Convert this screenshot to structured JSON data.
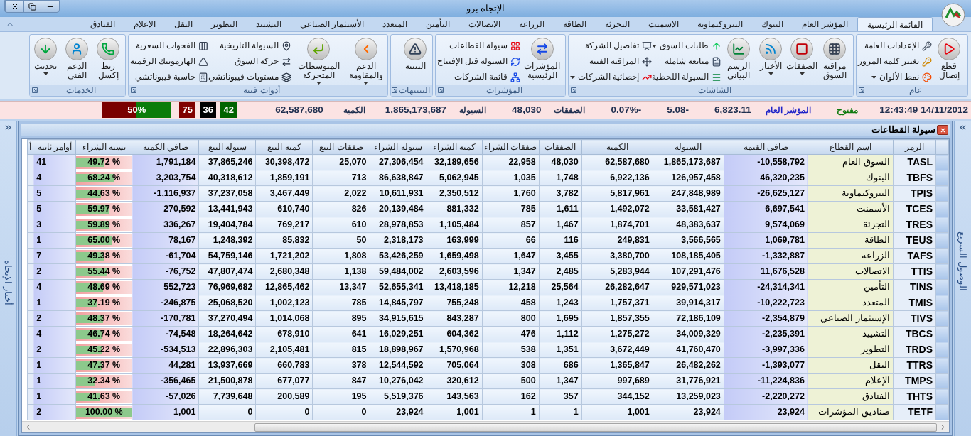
{
  "window": {
    "title": "الإتجاه برو"
  },
  "tabs": [
    {
      "label": "القائمة الرئيسية",
      "selected": true
    },
    {
      "label": "المؤشر العام",
      "selected": false
    },
    {
      "label": "البنوك",
      "selected": false
    },
    {
      "label": "البتروكيماوية",
      "selected": false
    },
    {
      "label": "الاسمنت",
      "selected": false
    },
    {
      "label": "التجزئة",
      "selected": false
    },
    {
      "label": "الطاقة",
      "selected": false
    },
    {
      "label": "الزراعة",
      "selected": false
    },
    {
      "label": "الاتصالات",
      "selected": false
    },
    {
      "label": "التأمين",
      "selected": false
    },
    {
      "label": "المتعدد",
      "selected": false
    },
    {
      "label": "الأستثمار الصناعي",
      "selected": false
    },
    {
      "label": "التشييد",
      "selected": false
    },
    {
      "label": "التطوير",
      "selected": false
    },
    {
      "label": "النقل",
      "selected": false
    },
    {
      "label": "الاعلام",
      "selected": false
    },
    {
      "label": "الفنادق",
      "selected": false
    }
  ],
  "ribbon": [
    {
      "title": "عام",
      "large": [
        {
          "label": "قطع إتصال",
          "dropdown": false
        }
      ],
      "small": [
        [
          {
            "label": "الإعدادات العامة",
            "dropdown": false
          },
          {
            "label": "تغيير كلمة المرور",
            "dropdown": false
          },
          {
            "label": "نمط الألوان",
            "dropdown": true
          }
        ]
      ]
    },
    {
      "title": "الشاشات",
      "large": [
        {
          "label": "مراقبة السوق",
          "dropdown": false
        },
        {
          "label": "الصفقات",
          "dropdown": true
        },
        {
          "label": "الأخبار",
          "dropdown": true
        },
        {
          "label": "الرسم البيانى",
          "dropdown": false
        }
      ],
      "small": [
        [
          {
            "label": "طلبات السوق",
            "dropdown": true
          },
          {
            "label": "متابعة شاملة",
            "dropdown": false
          },
          {
            "label": "السيولة اللحظية",
            "dropdown": false
          }
        ],
        [
          {
            "label": "تفاصيل الشركة",
            "dropdown": false
          },
          {
            "label": "المراقبة الفنية",
            "dropdown": false
          },
          {
            "label": "إحصائية الشركات",
            "dropdown": true
          }
        ]
      ]
    },
    {
      "title": "المؤشرات",
      "large": [
        {
          "label": "المؤشرات الرئيسية",
          "dropdown": false
        }
      ],
      "small": [
        [
          {
            "label": "سيولة القطاعات",
            "dropdown": false
          },
          {
            "label": "السيولة قبل الإفتتاح",
            "dropdown": false
          },
          {
            "label": "قائمة الشركات",
            "dropdown": false
          }
        ]
      ]
    },
    {
      "title": "التنبيهات",
      "large": [
        {
          "label": "التنبيه",
          "dropdown": false
        }
      ]
    },
    {
      "title": "أدوات فنية",
      "large": [
        {
          "label": "الدعم والمقاومة",
          "dropdown": true
        },
        {
          "label": "المتوسطات المتحركة",
          "dropdown": true
        }
      ],
      "small": [
        [
          {
            "label": "السيولة التاريخية",
            "dropdown": false
          },
          {
            "label": "حركة السوق",
            "dropdown": false
          },
          {
            "label": "مستويات فيبوناتشي",
            "dropdown": false
          }
        ],
        [
          {
            "label": "الفجوات السعرية",
            "dropdown": false
          },
          {
            "label": "الهارمونيك الرقمية",
            "dropdown": false
          },
          {
            "label": "حاسبة فيبوناتشي",
            "dropdown": false
          }
        ]
      ]
    },
    {
      "title": "الخدمات",
      "large": [
        {
          "label": "ربط إكسل",
          "dropdown": false
        },
        {
          "label": "الدعم الفني",
          "dropdown": false
        },
        {
          "label": "تحديث",
          "dropdown": true
        }
      ]
    }
  ],
  "ticker": {
    "date": "14/11/2012",
    "time": "12:43:49",
    "status": "مفتوح",
    "index_link": "المؤشر العام",
    "index_value": "6,823.11",
    "change": "5.08-",
    "change_pct": "0.07%-",
    "deals_label": "الصفقات",
    "deals": "48,030",
    "liquidity_label": "السيولة",
    "liquidity": "1,865,173,687",
    "quantity_label": "الكمية",
    "quantity": "62,587,680",
    "counts": [
      {
        "text": "42",
        "color": "#006400"
      },
      {
        "text": "36",
        "color": "#000000"
      },
      {
        "text": "75",
        "color": "#800000"
      }
    ],
    "ratio": {
      "text": "50%",
      "level": 0.5
    }
  },
  "side_panels": {
    "left": "أخبار الإتجاه",
    "right": "الوصول السريع"
  },
  "table_window": {
    "title": "سيولة القطاعات",
    "columns": [
      "الرمز",
      "اسم القطاع",
      "صافى القيمة",
      "السيولة",
      "الكمية",
      "الصفقات",
      "صفقات الشراء",
      "كمية الشراء",
      "سيولة الشراء",
      "صفقات البيع",
      "كمية البيع",
      "سيولة البيع",
      "صافي الكمية",
      "نسبة الشراء",
      "أوامر ثابتة",
      "أ"
    ],
    "rows": [
      {
        "symbol": "TASL",
        "sector": "السوق العام",
        "values": [
          "-10,558,792",
          "1,865,173,687",
          "62,587,680",
          "48,030",
          "22,958",
          "32,189,656",
          "27,306,454",
          "25,070",
          "30,398,472",
          "37,865,246",
          "1,791,184"
        ],
        "buy_ratio": "49.72 %",
        "level": 0.4972,
        "fixed_orders": "41"
      },
      {
        "symbol": "TBFS",
        "sector": "البنوك",
        "values": [
          "46,320,235",
          "126,957,458",
          "6,922,136",
          "1,748",
          "1,035",
          "5,062,945",
          "86,638,847",
          "713",
          "1,859,191",
          "40,318,612",
          "3,203,754"
        ],
        "buy_ratio": "68.24 %",
        "level": 0.6824,
        "fixed_orders": "4"
      },
      {
        "symbol": "TPIS",
        "sector": "البتروكيماوية",
        "values": [
          "-26,625,127",
          "247,848,989",
          "5,817,961",
          "3,782",
          "1,760",
          "2,350,512",
          "10,611,931",
          "2,022",
          "3,467,449",
          "37,237,058",
          "-1,116,937"
        ],
        "buy_ratio": "44.63 %",
        "level": 0.4463,
        "fixed_orders": "5"
      },
      {
        "symbol": "TCES",
        "sector": "الأسمنت",
        "values": [
          "6,697,541",
          "33,581,427",
          "1,492,072",
          "1,611",
          "785",
          "881,332",
          "20,139,484",
          "826",
          "610,740",
          "13,441,943",
          "270,592"
        ],
        "buy_ratio": "59.97 %",
        "level": 0.5997,
        "fixed_orders": "5"
      },
      {
        "symbol": "TRES",
        "sector": "التجزئة",
        "values": [
          "9,574,069",
          "48,383,637",
          "1,874,701",
          "1,467",
          "857",
          "1,105,484",
          "28,978,853",
          "610",
          "769,217",
          "19,404,784",
          "336,267"
        ],
        "buy_ratio": "59.89 %",
        "level": 0.5989,
        "fixed_orders": "3"
      },
      {
        "symbol": "TEUS",
        "sector": "الطاقة",
        "values": [
          "1,069,781",
          "3,566,565",
          "249,831",
          "116",
          "66",
          "163,999",
          "2,318,173",
          "50",
          "85,832",
          "1,248,392",
          "78,167"
        ],
        "buy_ratio": "65.00 %",
        "level": 0.65,
        "fixed_orders": "1"
      },
      {
        "symbol": "TAFS",
        "sector": "الزراعة",
        "values": [
          "-1,332,887",
          "108,185,405",
          "3,380,700",
          "3,455",
          "1,647",
          "1,659,498",
          "53,426,259",
          "1,808",
          "1,721,202",
          "54,759,146",
          "-61,704"
        ],
        "buy_ratio": "49.38 %",
        "level": 0.4938,
        "fixed_orders": "7"
      },
      {
        "symbol": "TTIS",
        "sector": "الاتصالات",
        "values": [
          "11,676,528",
          "107,291,476",
          "5,283,944",
          "2,485",
          "1,347",
          "2,603,596",
          "59,484,002",
          "1,138",
          "2,680,348",
          "47,807,474",
          "-76,752"
        ],
        "buy_ratio": "55.44 %",
        "level": 0.5544,
        "fixed_orders": "2"
      },
      {
        "symbol": "TINS",
        "sector": "التأمين",
        "values": [
          "-24,314,341",
          "929,571,023",
          "26,282,647",
          "25,564",
          "12,218",
          "13,418,185",
          "52,655,341",
          "13,347",
          "12,865,462",
          "76,969,682",
          "552,723"
        ],
        "buy_ratio": "48.69 %",
        "level": 0.4869,
        "fixed_orders": "4"
      },
      {
        "symbol": "TMIS",
        "sector": "المتعدد",
        "values": [
          "-10,222,723",
          "39,914,317",
          "1,757,371",
          "1,243",
          "458",
          "755,248",
          "14,845,797",
          "785",
          "1,002,123",
          "25,068,520",
          "-246,875"
        ],
        "buy_ratio": "37.19 %",
        "level": 0.3719,
        "fixed_orders": "1"
      },
      {
        "symbol": "TIVS",
        "sector": "الإستثمار الصناعي",
        "values": [
          "-2,354,879",
          "72,186,109",
          "1,857,355",
          "1,695",
          "800",
          "843,287",
          "34,915,615",
          "895",
          "1,014,068",
          "37,270,494",
          "-170,781"
        ],
        "buy_ratio": "48.37 %",
        "level": 0.4837,
        "fixed_orders": "2"
      },
      {
        "symbol": "TBCS",
        "sector": "التشييد",
        "values": [
          "-2,235,391",
          "34,009,329",
          "1,275,272",
          "1,112",
          "476",
          "604,362",
          "16,029,251",
          "641",
          "678,910",
          "18,264,642",
          "-74,548"
        ],
        "buy_ratio": "46.74 %",
        "level": 0.4674,
        "fixed_orders": "4"
      },
      {
        "symbol": "TRDS",
        "sector": "التطوير",
        "values": [
          "-3,997,336",
          "41,760,470",
          "3,672,449",
          "1,351",
          "538",
          "1,570,968",
          "18,898,967",
          "815",
          "2,105,481",
          "22,896,303",
          "-534,513"
        ],
        "buy_ratio": "45.22 %",
        "level": 0.4522,
        "fixed_orders": "2"
      },
      {
        "symbol": "TTRS",
        "sector": "النقل",
        "values": [
          "-1,393,077",
          "26,482,262",
          "1,365,847",
          "686",
          "308",
          "705,064",
          "12,544,592",
          "378",
          "660,783",
          "13,937,669",
          "44,281"
        ],
        "buy_ratio": "47.37 %",
        "level": 0.4737,
        "fixed_orders": "1"
      },
      {
        "symbol": "TMPS",
        "sector": "الإعلام",
        "values": [
          "-11,224,836",
          "31,776,921",
          "997,689",
          "1,347",
          "500",
          "320,612",
          "10,276,042",
          "847",
          "677,077",
          "21,500,878",
          "-356,465"
        ],
        "buy_ratio": "32.34 %",
        "level": 0.3234,
        "fixed_orders": "1"
      },
      {
        "symbol": "THTS",
        "sector": "الفنادق",
        "values": [
          "-2,220,272",
          "13,259,023",
          "344,152",
          "357",
          "162",
          "143,563",
          "5,519,376",
          "195",
          "200,589",
          "7,739,648",
          "-57,026"
        ],
        "buy_ratio": "41.63 %",
        "level": 0.4163,
        "fixed_orders": "1"
      },
      {
        "symbol": "TETF",
        "sector": "صناديق المؤشرات",
        "values": [
          "23,924",
          "23,924",
          "1,001",
          "1",
          "1",
          "1,001",
          "23,924",
          "0",
          "0",
          "0",
          "1,001"
        ],
        "buy_ratio": "100.00 %",
        "level": 1,
        "fixed_orders": "2"
      }
    ]
  }
}
